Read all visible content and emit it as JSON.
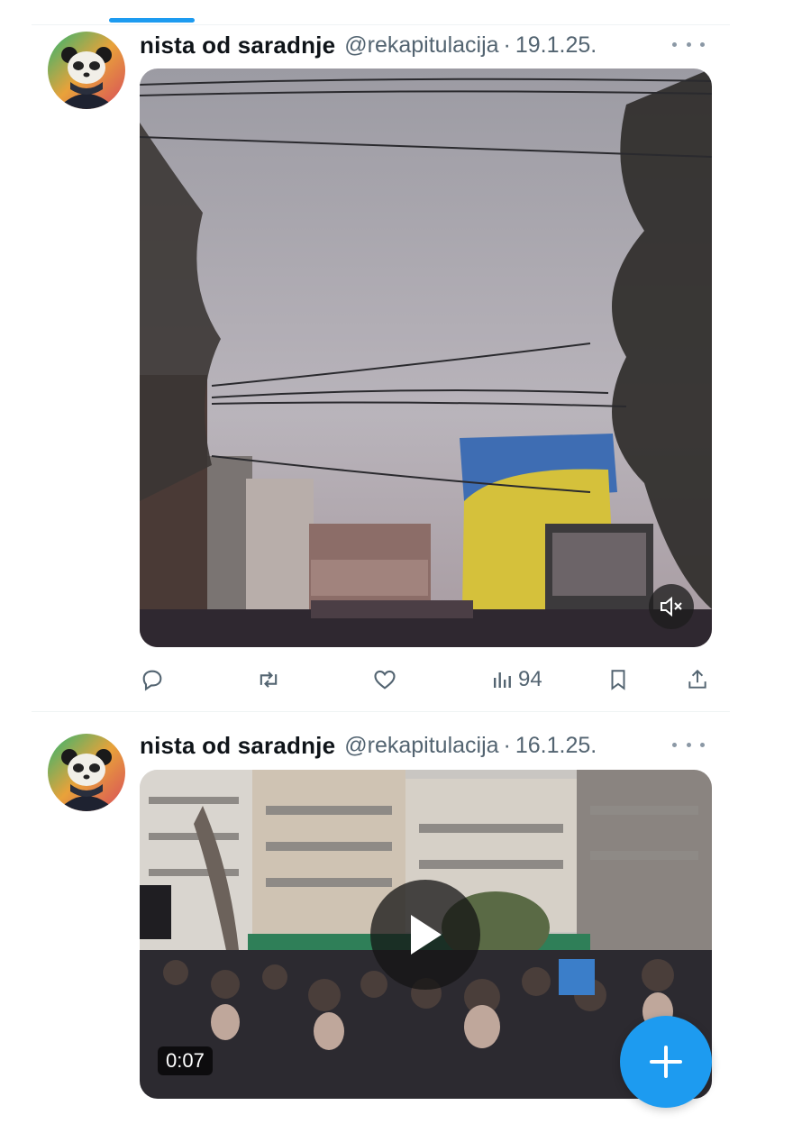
{
  "timeline": {
    "tweets": [
      {
        "display_name": "nista od saradnje",
        "handle": "@rekapitulacija",
        "separator": "·",
        "date": "19.1.25.",
        "media_type": "video",
        "muted": true,
        "views": "94",
        "icons": [
          "reply-icon",
          "retweet-icon",
          "like-icon",
          "views-icon",
          "bookmark-icon",
          "share-icon"
        ]
      },
      {
        "display_name": "nista od saradnje",
        "handle": "@rekapitulacija",
        "separator": "·",
        "date": "16.1.25.",
        "media_type": "video",
        "duration": "0:07"
      }
    ]
  },
  "compose_button": {
    "icon": "plus-icon",
    "color": "#1d9bf0"
  },
  "colors": {
    "accent": "#1d9bf0",
    "secondary_text": "#536471"
  }
}
